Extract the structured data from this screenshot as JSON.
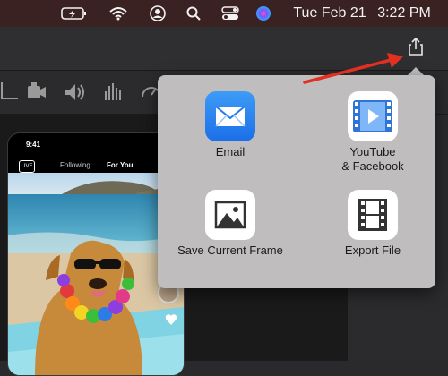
{
  "menubar": {
    "date": "Tue Feb 21",
    "time": "3:22 PM"
  },
  "phone_preview": {
    "time": "9:41",
    "live_label": "LIVE",
    "tab_following": "Following",
    "tab_for_you": "For You"
  },
  "share_popover": {
    "options": [
      {
        "label": "Email",
        "icon": "mail-icon"
      },
      {
        "label": "YouTube\n& Facebook",
        "icon": "youtube-facebook-icon"
      },
      {
        "label": "Save Current Frame",
        "icon": "image-frame-icon"
      },
      {
        "label": "Export File",
        "icon": "film-strip-icon"
      }
    ]
  },
  "colors": {
    "popover_bg": "#bfbdbe",
    "arrow_annotation": "#e03020",
    "email_blue": "#1f7cf0",
    "menubar": "#3a2222"
  }
}
